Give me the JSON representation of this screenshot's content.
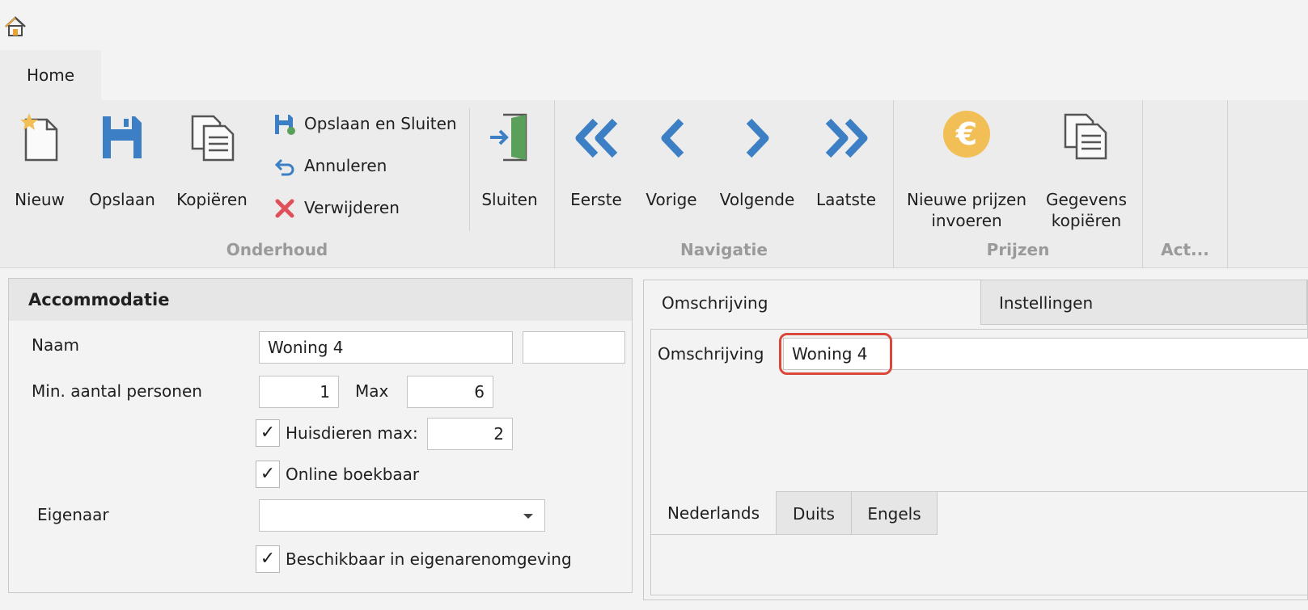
{
  "qat": {
    "home_icon": "home-icon"
  },
  "tabs": {
    "home": "Home"
  },
  "ribbon": {
    "nieuw": "Nieuw",
    "opslaan": "Opslaan",
    "kopieren": "Kopiëren",
    "opslaan_sluiten": "Opslaan en Sluiten",
    "annuleren": "Annuleren",
    "verwijderen": "Verwijderen",
    "sluiten": "Sluiten",
    "group_onderhoud": "Onderhoud",
    "eerste": "Eerste",
    "vorige": "Vorige",
    "volgende": "Volgende",
    "laatste": "Laatste",
    "group_navigatie": "Navigatie",
    "nieuwe_prijzen_1": "Nieuwe prijzen",
    "nieuwe_prijzen_2": "invoeren",
    "gegevens_kopieren_1": "Gegevens",
    "gegevens_kopieren_2": "kopiëren",
    "group_prijzen": "Prijzen",
    "group_act": "Act..."
  },
  "accommodatie": {
    "title": "Accommodatie",
    "naam_label": "Naam",
    "naam_value": "Woning 4",
    "naam_extra_value": "",
    "min_label": "Min. aantal personen",
    "min_value": "1",
    "max_label": "Max",
    "max_value": "6",
    "huisdieren_checked": true,
    "huisdieren_label": "Huisdieren max:",
    "huisdieren_value": "2",
    "online_checked": true,
    "online_label": "Online boekbaar",
    "eigenaar_label": "Eigenaar",
    "eigenaar_value": "",
    "beschikbaar_checked": true,
    "beschikbaar_label": "Beschikbaar in eigenarenomgeving"
  },
  "details": {
    "tab_omschrijving": "Omschrijving",
    "tab_instellingen": "Instellingen",
    "omschrijving_label": "Omschrijving",
    "omschrijving_value": "Woning 4",
    "lang_tabs": [
      "Nederlands",
      "Duits",
      "Engels"
    ]
  },
  "colors": {
    "accent_blue": "#3d7fc4",
    "delete_red": "#e0505a",
    "euro_gold": "#f2bf57",
    "highlight_red": "#d9483b"
  }
}
